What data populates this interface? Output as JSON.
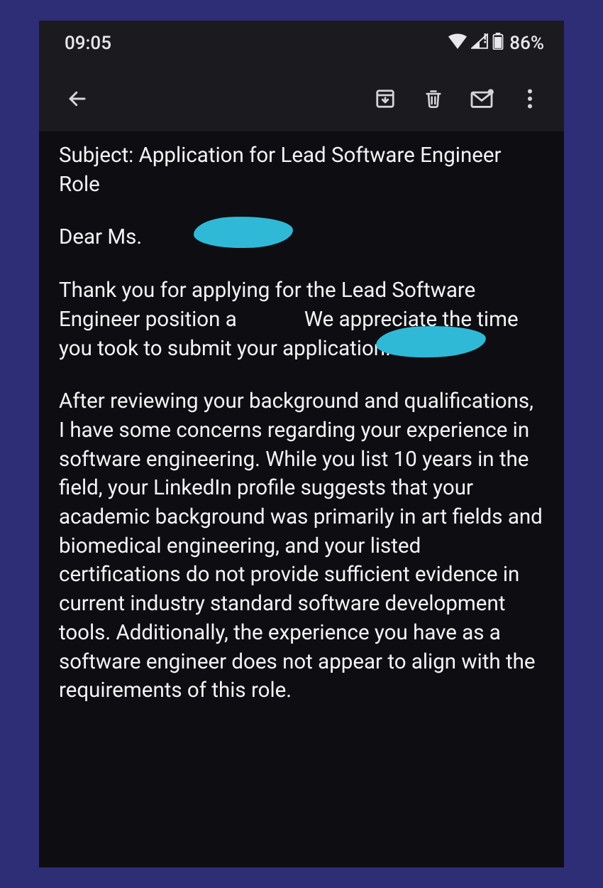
{
  "status": {
    "time": "09:05",
    "battery_pct": "86%"
  },
  "email": {
    "subject_label": "Subject:",
    "subject_text": "Application for Lead Software Engineer Role",
    "greeting_label": "Dear Ms.",
    "para1_a": "Thank you for applying for the Lead Software Engineer position a",
    "para1_b": "We appreciate the time you took to submit your application.",
    "para2": "After reviewing your background and qualifications, I have some concerns regarding your experience in software engineering. While you list 10 years in the field, your LinkedIn profile suggests that your academic background was primarily in art fields and biomedical engineering, and your listed certifications do not provide sufficient evidence in current industry standard software development tools. Additionally, the experience you have as a software engineer does not appear to align with the requirements of this role."
  }
}
